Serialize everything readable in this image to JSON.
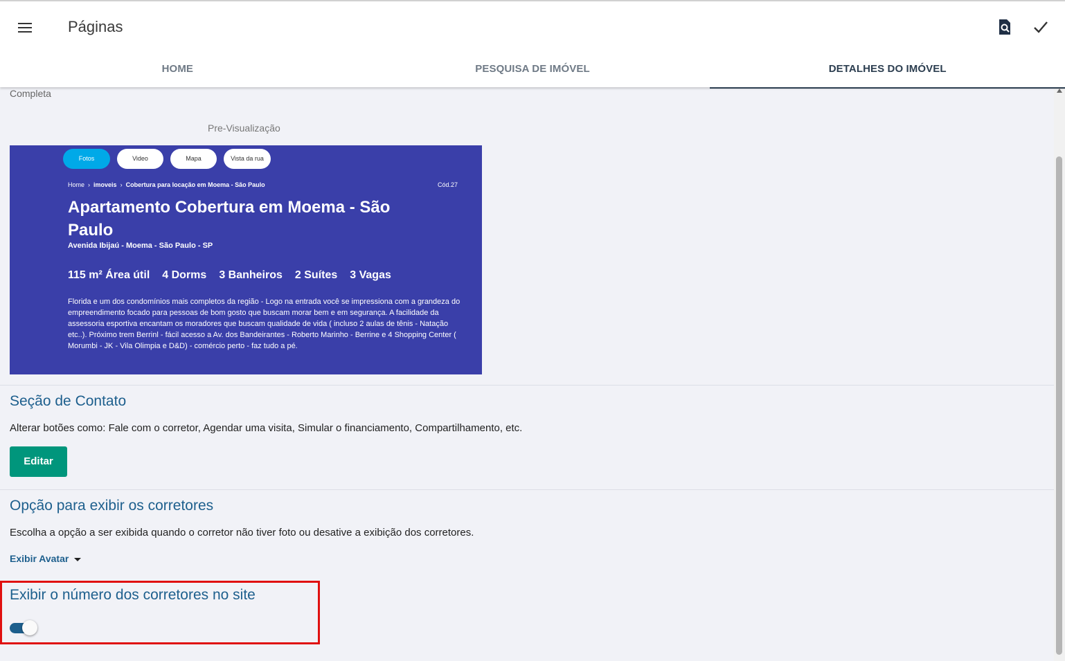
{
  "header": {
    "title": "Páginas",
    "menu_icon": "hamburger-menu-icon",
    "preview_icon": "search-document-icon",
    "save_icon": "check-icon"
  },
  "tabs": [
    {
      "label": "HOME",
      "active": false
    },
    {
      "label": "PESQUISA DE IMÓVEL",
      "active": false
    },
    {
      "label": "DETALHES DO IMÓVEL",
      "active": true
    }
  ],
  "layout_option": "Completa",
  "preview": {
    "label": "Pre-Visualização",
    "pills": [
      {
        "label": "Fotos",
        "active": true
      },
      {
        "label": "Video",
        "active": false
      },
      {
        "label": "Mapa",
        "active": false
      },
      {
        "label": "Vista da rua",
        "active": false
      }
    ],
    "breadcrumb": {
      "home": "Home",
      "sep": "›",
      "imoveis": "imoveis",
      "current": "Cobertura para locação em Moema - São Paulo"
    },
    "code": "Cód.27",
    "title": "Apartamento Cobertura em Moema - São Paulo",
    "address": "Avenida Ibijaú - Moema - São Paulo - SP",
    "features": [
      "115 m² Área útil",
      "4 Dorms",
      "3 Banheiros",
      "2 Suítes",
      "3 Vagas"
    ],
    "description": "Florida e um dos condomínios mais completos da região - Logo na entrada você se impressiona com a grandeza do empreendimento focado para pessoas de bom gosto que buscam morar bem e em segurança. A facilidade da assessoria esportiva encantam os moradores que buscam qualidade de vida ( incluso 2 aulas de tênis - Natação etc..). Próximo trem Berrinl - fácil acesso a Av. dos Bandeirantes - Roberto Marinho - Berrine e 4 Shopping Center ( Morumbi - JK - Vila Olimpia e D&D) - comércio perto - faz tudo a pé.",
    "background_color": "#3a3fa9"
  },
  "contact_section": {
    "title": "Seção de Contato",
    "description": "Alterar botões como: Fale com o corretor, Agendar uma visita, Simular o financiamento, Compartilhamento, etc.",
    "edit_label": "Editar"
  },
  "brokers_section": {
    "title": "Opção para exibir os corretores",
    "description": "Escolha a opção a ser exibida quando o corretor não tiver foto ou desative a exibição dos corretores.",
    "selected_option": "Exibir Avatar"
  },
  "broker_number_section": {
    "title": "Exibir o número dos corretores no site",
    "enabled": true
  },
  "colors": {
    "accent": "#1d5f8d",
    "button": "#00967c",
    "highlight": "#e01010",
    "active_pill": "#00a9e8"
  }
}
